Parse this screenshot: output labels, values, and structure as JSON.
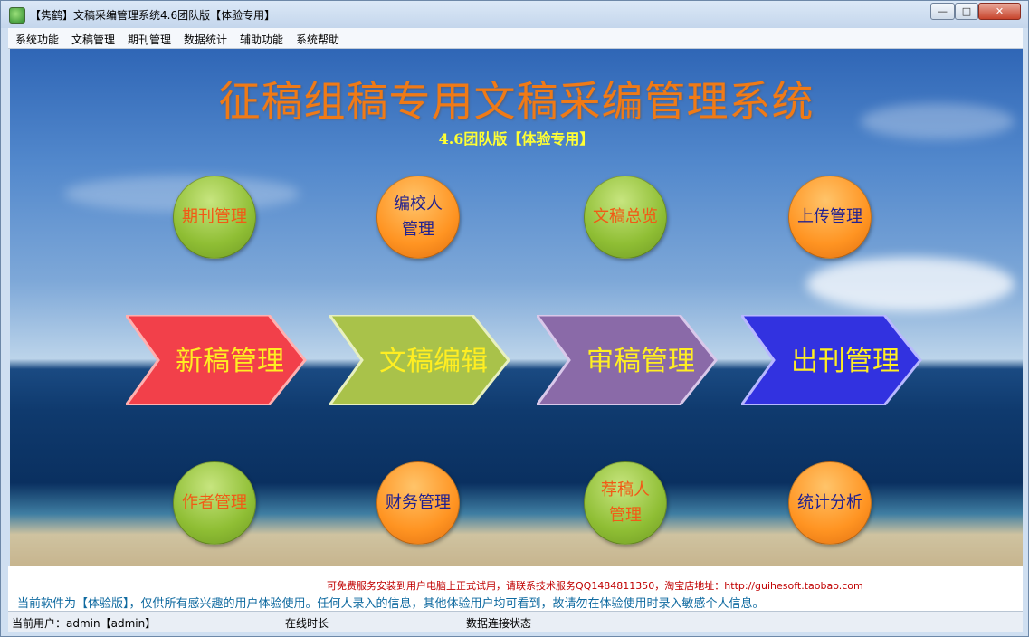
{
  "window": {
    "title": "【隽鹤】文稿采编管理系统4.6团队版【体验专用】",
    "buttons": {
      "minimize": "—",
      "maximize": "□",
      "close": "✕"
    }
  },
  "menu": [
    "系统功能",
    "文稿管理",
    "期刊管理",
    "数据统计",
    "辅助功能",
    "系统帮助"
  ],
  "banner": {
    "title": "征稿组稿专用文稿采编管理系统",
    "subtitle": "4.6团队版【体验专用】"
  },
  "top_circles": [
    {
      "label": "期刊管理",
      "color": "green"
    },
    {
      "label": "编校人\n管理",
      "color": "orange"
    },
    {
      "label": "文稿总览",
      "color": "green"
    },
    {
      "label": "上传管理",
      "color": "orange"
    }
  ],
  "arrows": [
    {
      "label": "新稿管理",
      "fill": "#f2404a",
      "text_color": "#ffee22"
    },
    {
      "label": "文稿编辑",
      "fill": "#a9c24a",
      "text_color": "#ffee22"
    },
    {
      "label": "审稿管理",
      "fill": "#8a6aa8",
      "text_color": "#ffee22"
    },
    {
      "label": "出刊管理",
      "fill": "#3232e0",
      "text_color": "#ffee22"
    }
  ],
  "bottom_circles": [
    {
      "label": "作者管理",
      "color": "green"
    },
    {
      "label": "财务管理",
      "color": "orange"
    },
    {
      "label": "荐稿人\n管理",
      "color": "green"
    },
    {
      "label": "统计分析",
      "color": "orange"
    }
  ],
  "notice": {
    "red_line": "可免费服务安装到用户电脑上正式试用，请联系技术服务QQ1484811350，淘宝店地址：http://guihesoft.taobao.com",
    "blue_line": "当前软件为【体验版】，仅供所有感兴趣的用户体验使用。任何人录入的信息，其他体验用户均可看到，故请勿在体验使用时录入敏感个人信息。"
  },
  "status": {
    "user": "当前用户：admin【admin】",
    "online_time": "在线时长",
    "db_status": "数据连接状态"
  }
}
